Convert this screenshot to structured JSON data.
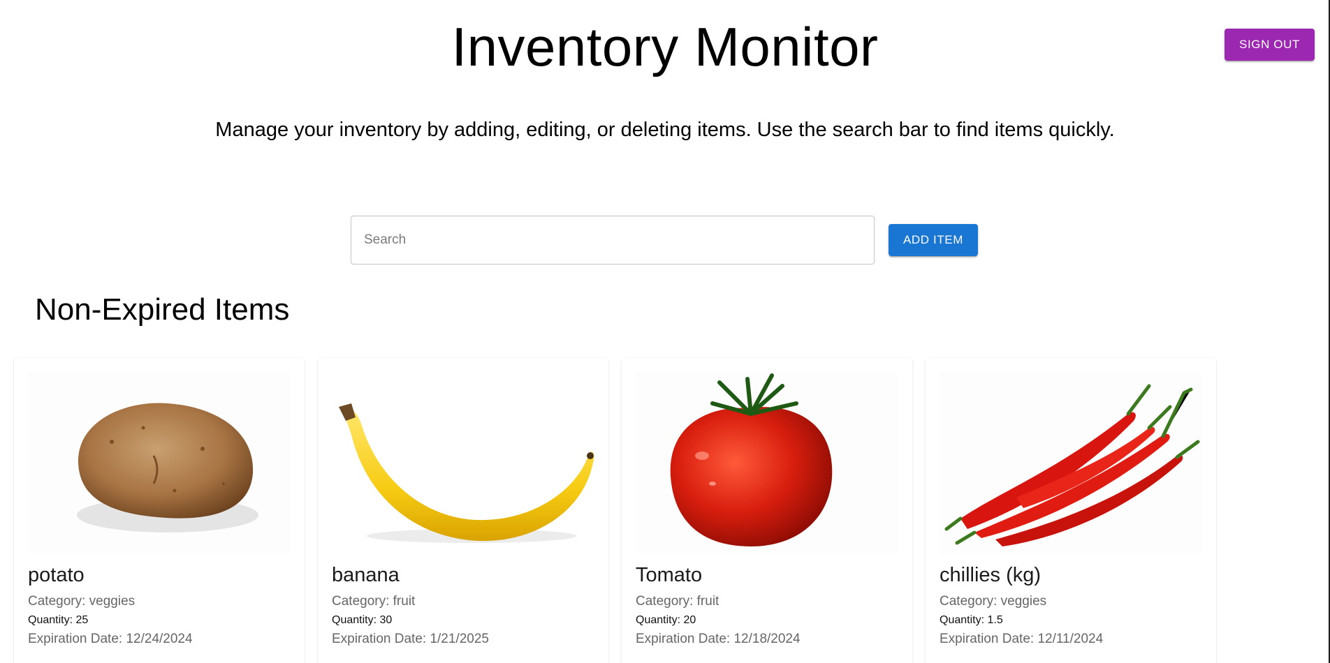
{
  "header": {
    "title": "Inventory Monitor",
    "signout_label": "SIGN OUT",
    "subtitle": "Manage your inventory by adding, editing, or deleting items. Use the search bar to find items quickly."
  },
  "toolbar": {
    "search_placeholder": "Search",
    "search_value": "",
    "add_label": "ADD ITEM"
  },
  "colors": {
    "primary": "#1976d2",
    "secondary": "#9c27b0"
  },
  "section": {
    "title": "Non-Expired Items"
  },
  "items": [
    {
      "name": "potato",
      "category": "Category: veggies",
      "quantity": "Quantity: 25",
      "expiration": "Expiration Date: 12/24/2024",
      "image": "potato-image"
    },
    {
      "name": "banana",
      "category": "Category: fruit",
      "quantity": "Quantity: 30",
      "expiration": "Expiration Date: 1/21/2025",
      "image": "banana-image"
    },
    {
      "name": "Tomato",
      "category": "Category: fruit",
      "quantity": "Quantity: 20",
      "expiration": "Expiration Date: 12/18/2024",
      "image": "tomato-image"
    },
    {
      "name": "chillies (kg)",
      "category": "Category: veggies",
      "quantity": "Quantity: 1.5",
      "expiration": "Expiration Date: 12/11/2024",
      "image": "chillies-image"
    }
  ]
}
